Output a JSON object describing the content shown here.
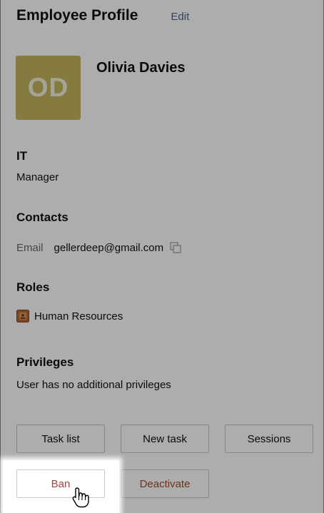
{
  "header": {
    "title": "Employee Profile",
    "edit_label": "Edit"
  },
  "profile": {
    "initials": "OD",
    "name": "Olivia Davies",
    "avatar_color": "#c4b560"
  },
  "department": {
    "heading": "IT",
    "position": "Manager"
  },
  "contacts": {
    "heading": "Contacts",
    "email_label": "Email",
    "email_value": "gellerdeep@gmail.com",
    "copy_icon": "copy-icon"
  },
  "roles": {
    "heading": "Roles",
    "items": [
      {
        "label": "Human Resources",
        "icon": "role-badge-icon"
      }
    ]
  },
  "privileges": {
    "heading": "Privileges",
    "text": "User has no additional privileges"
  },
  "actions": {
    "task_list": "Task list",
    "new_task": "New task",
    "sessions": "Sessions",
    "ban": "Ban",
    "deactivate": "Deactivate"
  },
  "colors": {
    "danger": "#b0413e",
    "link": "#4a5f86"
  }
}
